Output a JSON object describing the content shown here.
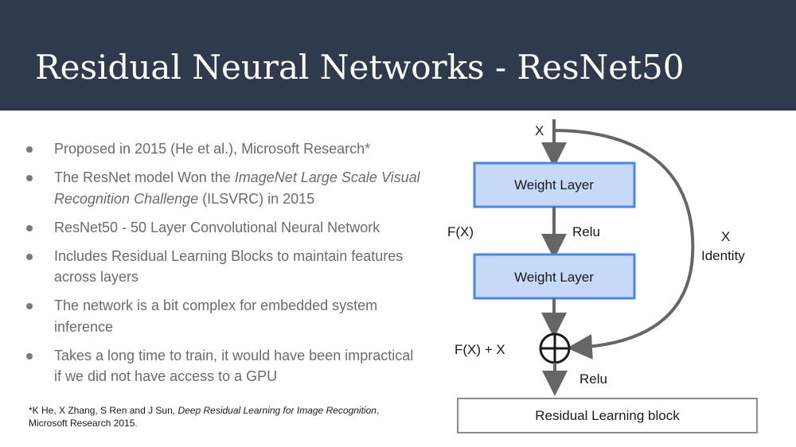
{
  "slide": {
    "title": "Residual Neural Networks - ResNet50"
  },
  "bullets": [
    {
      "parts": [
        {
          "text": "Proposed in 2015 (He et al.), Microsoft Research*",
          "italic": false
        }
      ]
    },
    {
      "parts": [
        {
          "text": "The ResNet model Won the ",
          "italic": false
        },
        {
          "text": "ImageNet Large Scale Visual Recognition Challenge",
          "italic": true
        },
        {
          "text": " (ILSVRC) in 2015",
          "italic": false
        }
      ]
    },
    {
      "parts": [
        {
          "text": "ResNet50 - 50 Layer Convolutional Neural Network",
          "italic": false
        }
      ]
    },
    {
      "parts": [
        {
          "text": "Includes Residual Learning Blocks to maintain features across layers",
          "italic": false
        }
      ]
    },
    {
      "parts": [
        {
          "text": "The network is a bit complex for embedded system inference",
          "italic": false
        }
      ]
    },
    {
      "parts": [
        {
          "text": "Takes a long time to train, it would have been impractical if we did not have access to a GPU",
          "italic": false
        }
      ]
    }
  ],
  "citation": {
    "prefix": "*K He, X Zhang, S Ren and J Sun, ",
    "title": "Deep Residual Learning for Image Recognition",
    "suffix": ",",
    "line2": "Microsoft Research 2015."
  },
  "diagram": {
    "input_label": "X",
    "layer1_label": "Weight Layer",
    "layer2_label": "Weight Layer",
    "fx_label": "F(X)",
    "relu1_label": "Relu",
    "identity_x_label": "X",
    "identity_label": "Identity",
    "sum_label": "F(X) + X",
    "relu2_label": "Relu",
    "caption": "Residual Learning block"
  },
  "colors": {
    "header_bg": "#2f3a4d",
    "layer_fill": "#c6d9f7",
    "layer_stroke": "#4a86e8",
    "arrow": "#666666"
  }
}
